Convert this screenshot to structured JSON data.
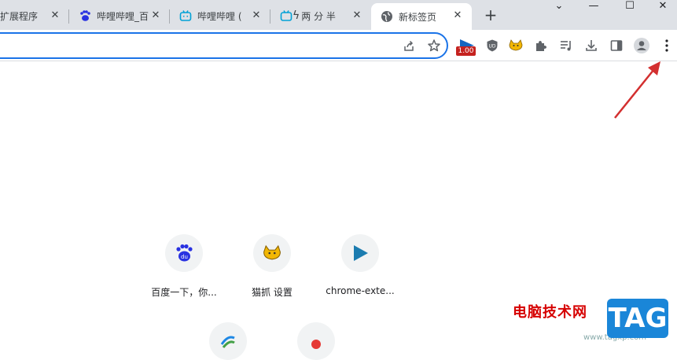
{
  "tabs": [
    {
      "label": "扩展程序",
      "icon": "puzzle-icon"
    },
    {
      "label": "哔哩哔哩_百",
      "icon": "baidu-paw-icon"
    },
    {
      "label": "哔哩哔哩 (",
      "icon": "bilibili-icon"
    },
    {
      "label": "两 分 半",
      "icon": "bilibili-icon"
    },
    {
      "label": "新标签页",
      "icon": "globe-icon"
    }
  ],
  "extensions": {
    "badge_text": "1.00"
  },
  "shortcuts": [
    {
      "label": "百度一下，你...",
      "icon": "baidu-icon"
    },
    {
      "label": "猫抓 设置",
      "icon": "cat-catch-icon"
    },
    {
      "label": "chrome-exte...",
      "icon": "play-icon"
    }
  ],
  "watermark": {
    "site": "电脑技术网",
    "url": "www.tagxp.com",
    "tag": "TAG"
  },
  "colors": {
    "tabbar": "#dee1e6",
    "accent": "#1a73e8",
    "arrow": "#d32f2f"
  }
}
